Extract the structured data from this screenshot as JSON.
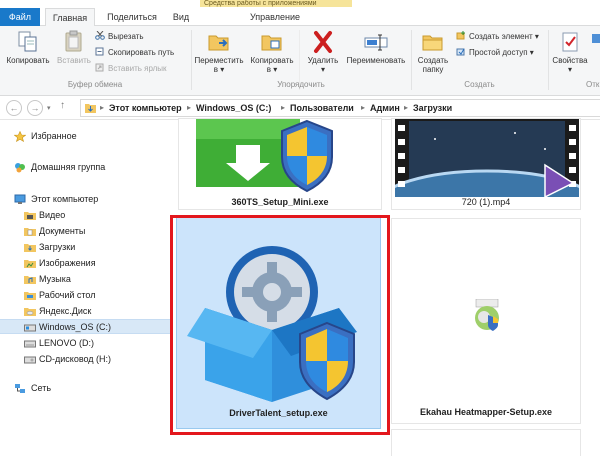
{
  "titlebar": {
    "context_group_label": "Средства работы с приложениями"
  },
  "tabs": {
    "file": "Файл",
    "home": "Главная",
    "share": "Поделиться",
    "view": "Вид",
    "manage": "Управление"
  },
  "ribbon": {
    "clipboard": {
      "label": "Буфер обмена",
      "copy": "Копировать",
      "paste": "Вставить",
      "cut": "Вырезать",
      "copy_path": "Скопировать путь",
      "paste_shortcut": "Вставить ярлык"
    },
    "organize": {
      "label": "Упорядочить",
      "move_to_l1": "Переместить",
      "move_to_l2": "в ▾",
      "copy_to_l1": "Копировать",
      "copy_to_l2": "в ▾",
      "delete_l1": "Удалить",
      "delete_l2": "▾",
      "rename": "Переименовать"
    },
    "new": {
      "label": "Создать",
      "new_folder_l1": "Создать",
      "new_folder_l2": "папку",
      "new_item": "Создать элемент ▾",
      "easy_access": "Простой доступ ▾"
    },
    "open": {
      "properties_l1": "Свойства",
      "properties_l2": "▾",
      "label_partial": "Отк"
    }
  },
  "address": {
    "arrow": "▸",
    "crumbs": [
      "Этот компьютер",
      "Windows_OS (C:)",
      "Пользователи",
      "Админ",
      "Загрузки"
    ]
  },
  "nav": {
    "favorites": "Избранное",
    "homegroup": "Домашняя группа",
    "this_pc": "Этот компьютер",
    "items": [
      "Видео",
      "Документы",
      "Загрузки",
      "Изображения",
      "Музыка",
      "Рабочий стол",
      "Яндекс.Диск",
      "Windows_OS (C:)",
      "LENOVO (D:)",
      "CD-дисковод (H:)"
    ],
    "network": "Сеть"
  },
  "files": {
    "f1": "360TS_Setup_Mini.exe",
    "f2": "720 (1).mp4",
    "f3": "DriverTalent_setup.exe",
    "f4": "Ekahau Heatmapper-Setup.exe"
  },
  "colors": {
    "accent": "#1979ca",
    "selection_bg": "#cce4fb",
    "highlight_box": "#e3171d",
    "context_band": "#f6e49a"
  }
}
